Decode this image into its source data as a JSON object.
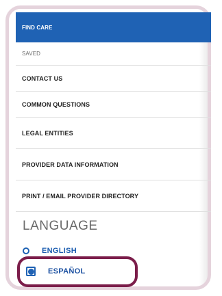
{
  "menu": {
    "items": [
      {
        "label": "FIND CARE"
      },
      {
        "label": "SAVED"
      },
      {
        "label": "CONTACT US"
      },
      {
        "label": "COMMON QUESTIONS"
      },
      {
        "label": "LEGAL ENTITIES"
      },
      {
        "label": "PROVIDER DATA INFORMATION"
      },
      {
        "label": "PRINT / EMAIL PROVIDER DIRECTORY"
      }
    ]
  },
  "language": {
    "title": "LANGUAGE",
    "options": [
      {
        "label": "ENGLISH",
        "selected": false
      },
      {
        "label": "ESPAÑOL",
        "selected": true
      }
    ]
  },
  "colors": {
    "accent": "#1f62b4",
    "highlight": "#7b1d4a",
    "frame": "#e5d3dc"
  }
}
